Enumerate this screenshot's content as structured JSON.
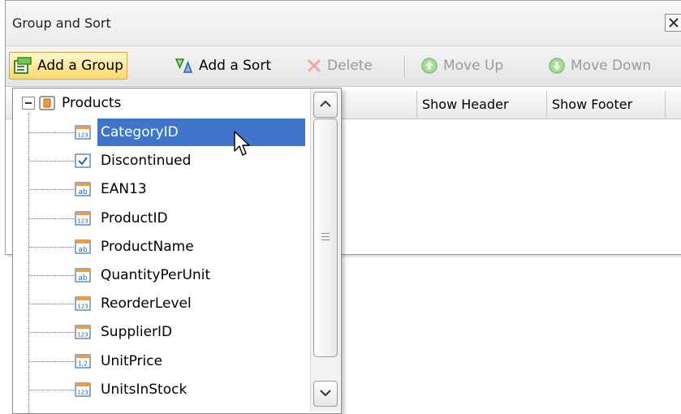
{
  "window": {
    "title": "Group and Sort",
    "close_glyph": "×"
  },
  "toolbar": {
    "add_group": "Add a Group",
    "add_sort": "Add a Sort",
    "delete": "Delete",
    "move_up": "Move Up",
    "move_down": "Move Down"
  },
  "grid": {
    "columns": [
      "Show Header",
      "Show Footer"
    ]
  },
  "tree": {
    "root": "Products",
    "items": [
      {
        "label": "CategoryID",
        "type": "numeric-icon",
        "selected": true
      },
      {
        "label": "Discontinued",
        "type": "checkbox-icon"
      },
      {
        "label": "EAN13",
        "type": "text-icon"
      },
      {
        "label": "ProductID",
        "type": "numeric-icon"
      },
      {
        "label": "ProductName",
        "type": "text-icon"
      },
      {
        "label": "QuantityPerUnit",
        "type": "text-icon"
      },
      {
        "label": "ReorderLevel",
        "type": "numeric-icon"
      },
      {
        "label": "SupplierID",
        "type": "numeric-icon"
      },
      {
        "label": "UnitPrice",
        "type": "decimal-icon"
      },
      {
        "label": "UnitsInStock",
        "type": "numeric-icon"
      }
    ]
  },
  "colors": {
    "selection": "#3f76c9",
    "toolbar_active": "#ffd86a",
    "disabled_text": "#9a9a9a"
  }
}
